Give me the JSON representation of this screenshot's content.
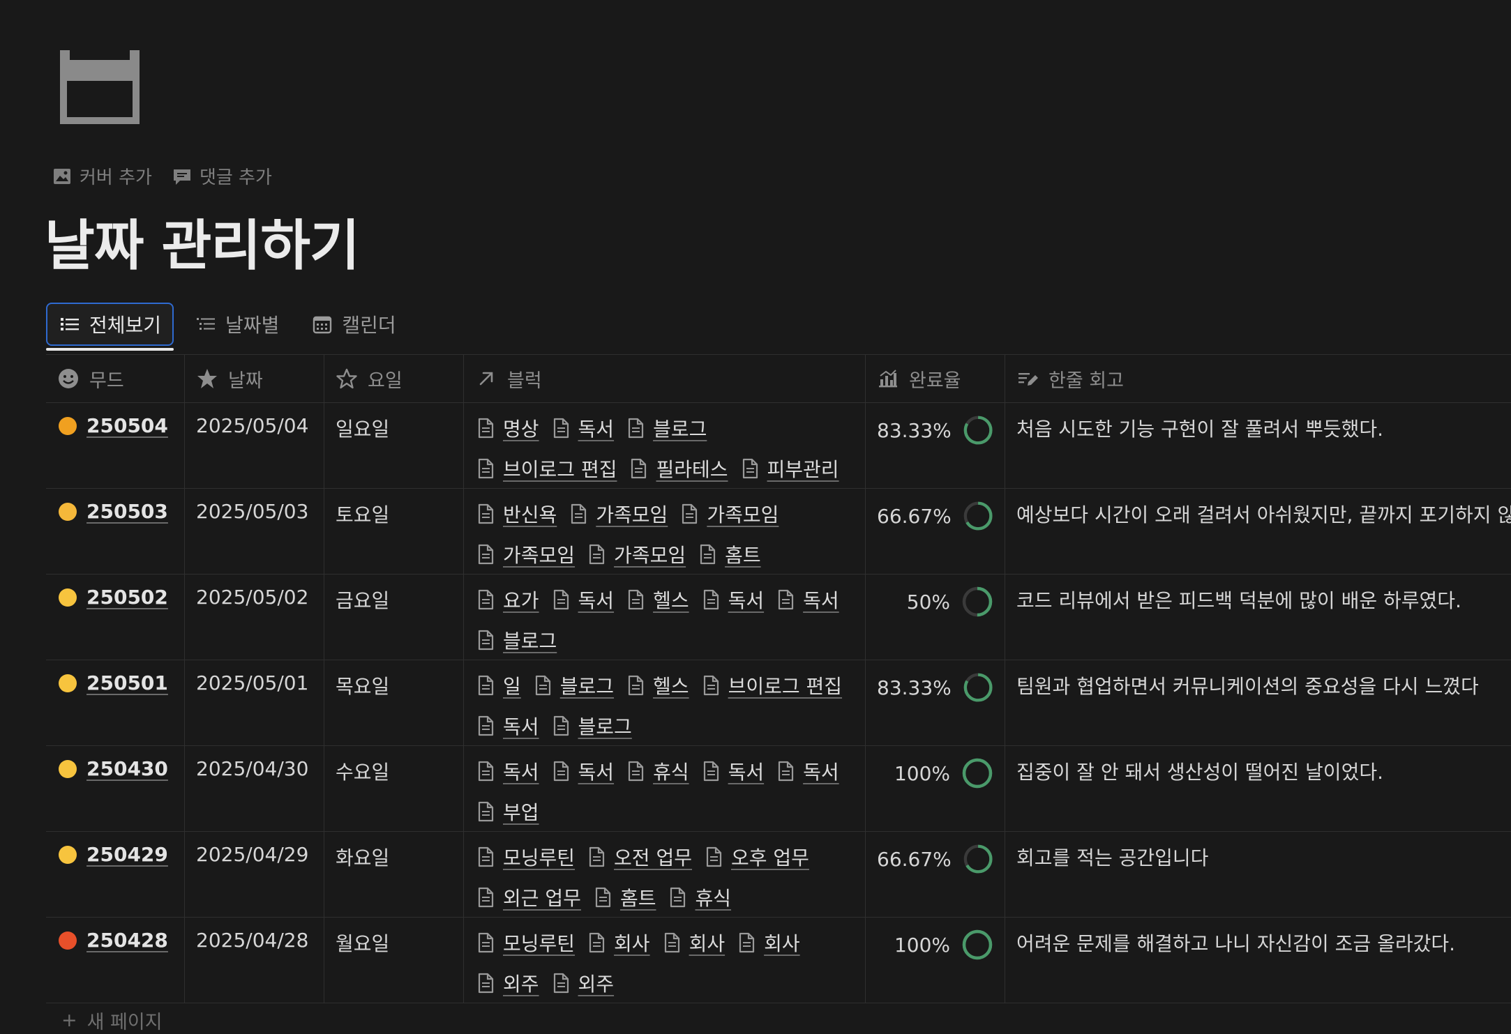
{
  "page_actions": {
    "add_cover": "커버 추가",
    "add_comment": "댓글 추가"
  },
  "title": "날짜 관리하기",
  "tabs": [
    {
      "label": "전체보기",
      "active": true
    },
    {
      "label": "날짜별",
      "active": false
    },
    {
      "label": "캘린더",
      "active": false
    }
  ],
  "columns": {
    "mood": "무드",
    "date": "날짜",
    "day": "요일",
    "blocks": "블럭",
    "rate": "완료율",
    "memo": "한줄 회고"
  },
  "rows": [
    {
      "emoji_color": "#f0a020",
      "name": "250504",
      "date": "2025/05/04",
      "day": "일요일",
      "links": [
        "명상",
        "독서",
        "블로그",
        "브이로그 편집",
        "필라테스",
        "피부관리"
      ],
      "rate_label": "83.33%",
      "rate": 0.8333,
      "memo": "처음 시도한 기능 구현이 잘 풀려서 뿌듯했다."
    },
    {
      "emoji_color": "#f5b83a",
      "name": "250503",
      "date": "2025/05/03",
      "day": "토요일",
      "links": [
        "반신욕",
        "가족모임",
        "가족모임",
        "가족모임",
        "가족모임",
        "홈트"
      ],
      "rate_label": "66.67%",
      "rate": 0.6667,
      "memo": "예상보다 시간이 오래 걸려서 아쉬웠지만, 끝까지 포기하지 않았다"
    },
    {
      "emoji_color": "#f7c43e",
      "name": "250502",
      "date": "2025/05/02",
      "day": "금요일",
      "links": [
        "요가",
        "독서",
        "헬스",
        "독서",
        "독서",
        "블로그"
      ],
      "rate_label": "50%",
      "rate": 0.5,
      "memo": "코드 리뷰에서 받은 피드백 덕분에 많이 배운 하루였다."
    },
    {
      "emoji_color": "#f7c43e",
      "name": "250501",
      "date": "2025/05/01",
      "day": "목요일",
      "links": [
        "일",
        "블로그",
        "헬스",
        "브이로그 편집",
        "독서",
        "블로그"
      ],
      "rate_label": "83.33%",
      "rate": 0.8333,
      "memo": "팀원과 협업하면서 커뮤니케이션의 중요성을 다시 느꼈다"
    },
    {
      "emoji_color": "#f7c43e",
      "name": "250430",
      "date": "2025/04/30",
      "day": "수요일",
      "links": [
        "독서",
        "독서",
        "휴식",
        "독서",
        "독서",
        "부업"
      ],
      "rate_label": "100%",
      "rate": 1,
      "memo": "집중이 잘 안 돼서 생산성이 떨어진 날이었다."
    },
    {
      "emoji_color": "#f7c43e",
      "name": "250429",
      "date": "2025/04/29",
      "day": "화요일",
      "links": [
        "모닝루틴",
        "오전 업무",
        "오후 업무",
        "외근 업무",
        "홈트",
        "휴식"
      ],
      "rate_label": "66.67%",
      "rate": 0.6667,
      "memo": "회고를 적는 공간입니다"
    },
    {
      "emoji_color": "#e8502a",
      "name": "250428",
      "date": "2025/04/28",
      "day": "월요일",
      "links": [
        "모닝루틴",
        "회사",
        "회사",
        "회사",
        "외주",
        "외주"
      ],
      "rate_label": "100%",
      "rate": 1,
      "memo": "어려운 문제를 해결하고 나니 자신감이 조금 올라갔다."
    }
  ],
  "new_page": "새 페이지",
  "colors": {
    "ring": "#4a9a6a",
    "ring_track": "#3a3a3a",
    "accent": "#2f6ad0"
  }
}
